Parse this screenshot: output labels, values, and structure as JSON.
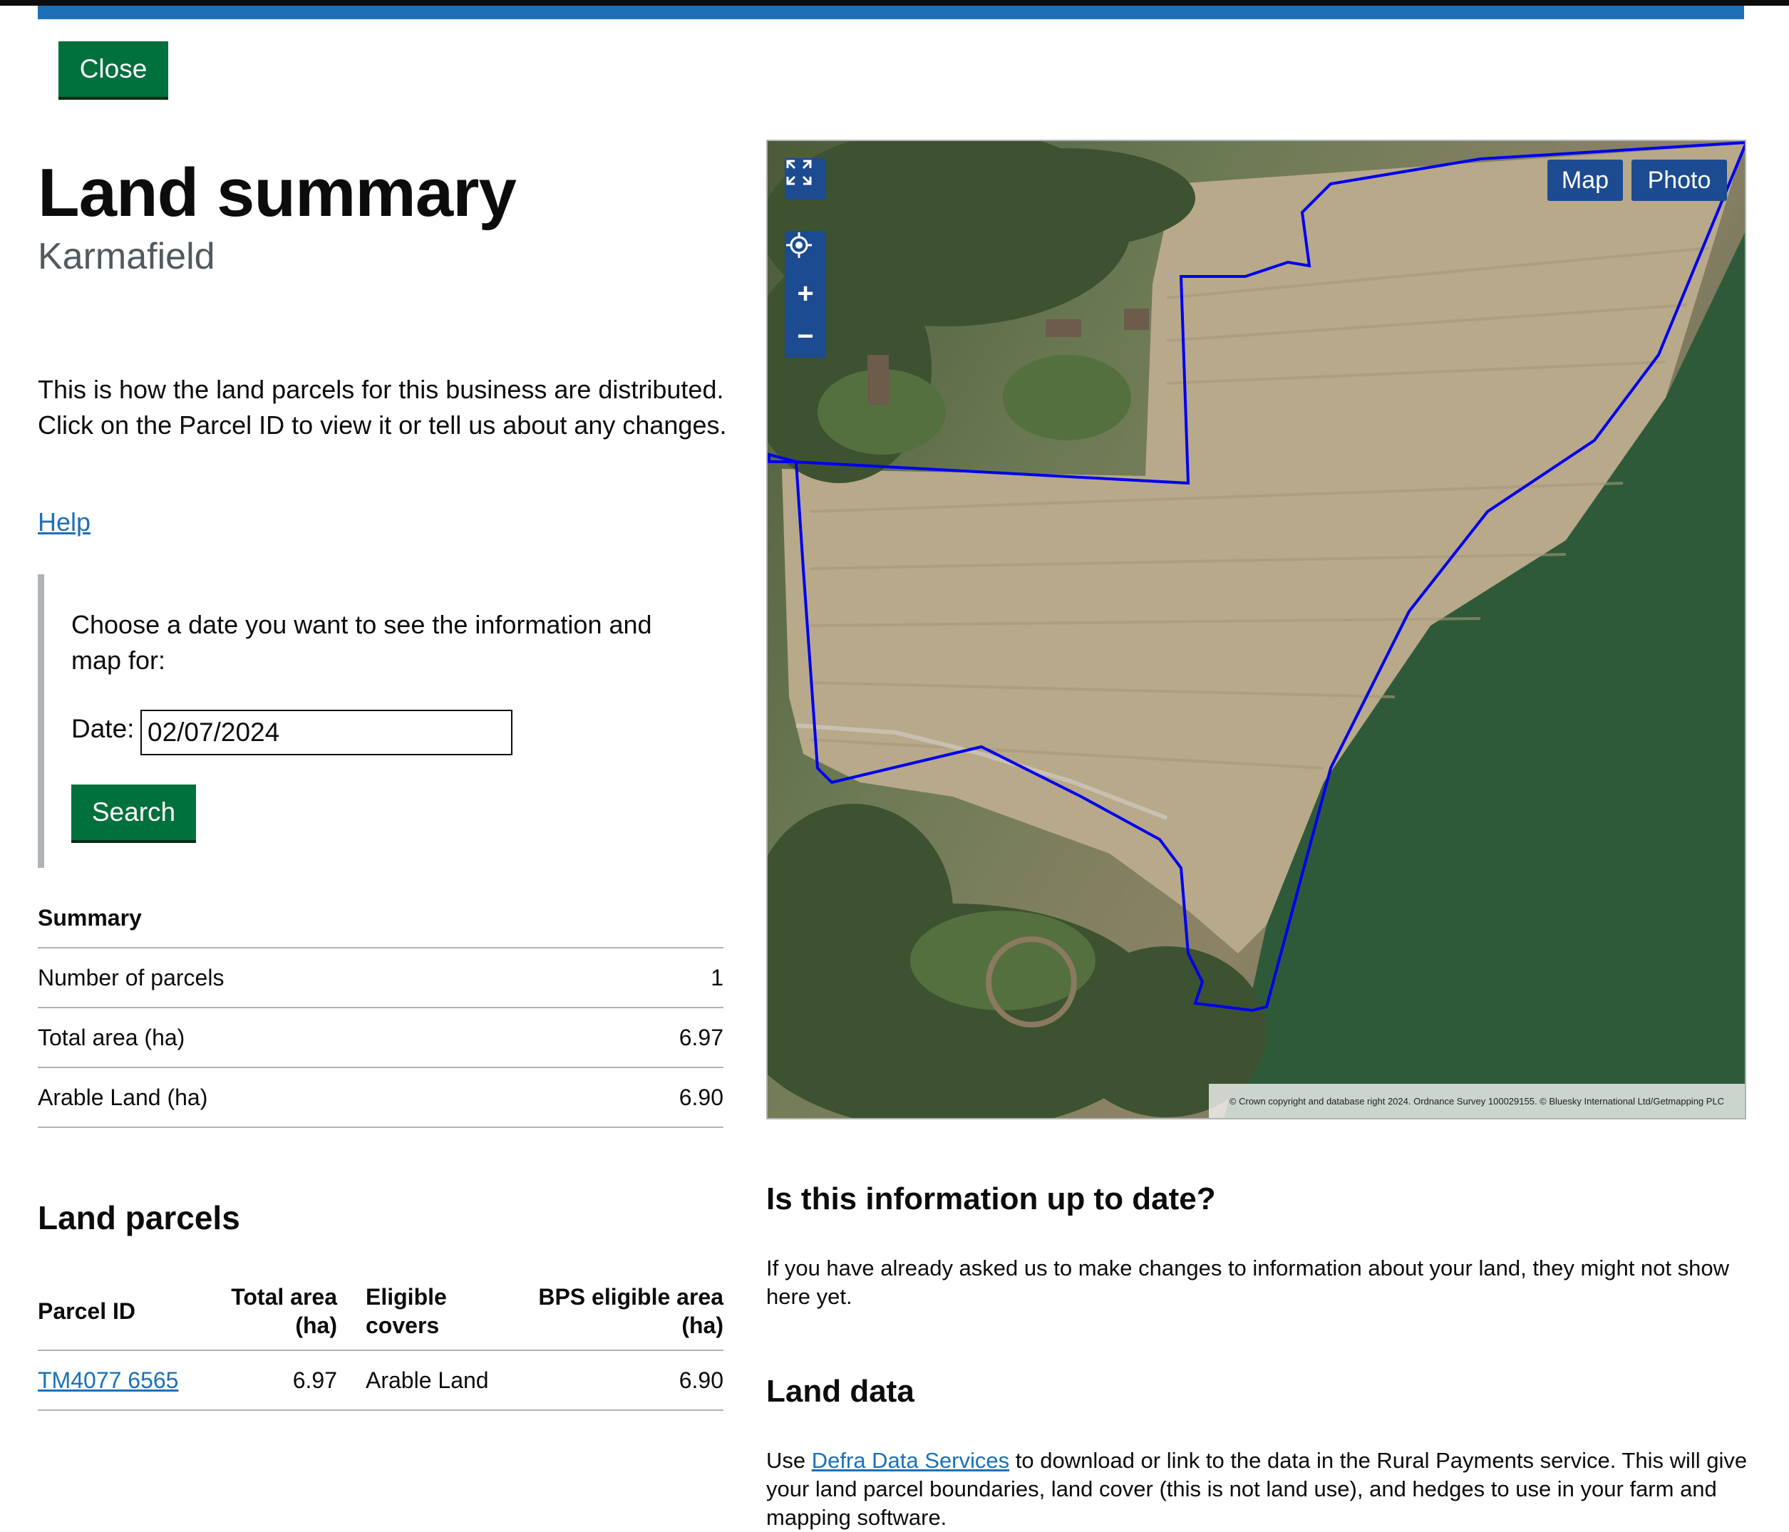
{
  "header": {
    "close_label": "Close"
  },
  "page": {
    "title": "Land summary",
    "caption": "Karmafield",
    "intro": "This is how the land parcels for this business are distributed. Click on the Parcel ID to view it or tell us about any changes.",
    "help_link": "Help"
  },
  "date_form": {
    "prompt": "Choose a date you want to see the information and map for:",
    "label": "Date:",
    "value": "02/07/2024",
    "search_label": "Search"
  },
  "summary": {
    "caption": "Summary",
    "rows": [
      {
        "label": "Number of parcels",
        "value": "1"
      },
      {
        "label": "Total area (ha)",
        "value": "6.97"
      },
      {
        "label": "Arable Land (ha)",
        "value": "6.90"
      }
    ]
  },
  "parcels": {
    "heading": "Land parcels",
    "headers": {
      "parcel_id": "Parcel ID",
      "total_area": "Total area (ha)",
      "eligible_covers": "Eligible covers",
      "bps_area": "BPS eligible area (ha)"
    },
    "rows": [
      {
        "parcel_id": "TM4077 6565",
        "total_area": "6.97",
        "eligible_covers": "Arable Land",
        "bps_area": "6.90"
      }
    ]
  },
  "map": {
    "toggle_map": "Map",
    "toggle_photo": "Photo",
    "attribution": "© Crown copyright and database right 2024. Ordnance Survey 100029155. © Bluesky International Ltd/Getmapping PLC",
    "boundary_color": "#0000ee",
    "icons": [
      "fullscreen-icon",
      "locate-icon",
      "zoom-in-icon",
      "zoom-out-icon"
    ]
  },
  "uptodate": {
    "heading": "Is this information up to date?",
    "text": "If you have already asked us to make changes to information about your land, they might not show here yet."
  },
  "land_data": {
    "heading": "Land data",
    "text_before": "Use ",
    "link": "Defra Data Services",
    "text_after": " to download or link to the data in the Rural Payments service. This will give your land parcel boundaries, land cover (this is not land use), and hedges to use in your farm and mapping software."
  },
  "colors": {
    "button_green": "#00703c",
    "link_blue": "#1d70b8",
    "header_blue": "#1d70b8",
    "map_control_blue": "#1d4b91"
  }
}
